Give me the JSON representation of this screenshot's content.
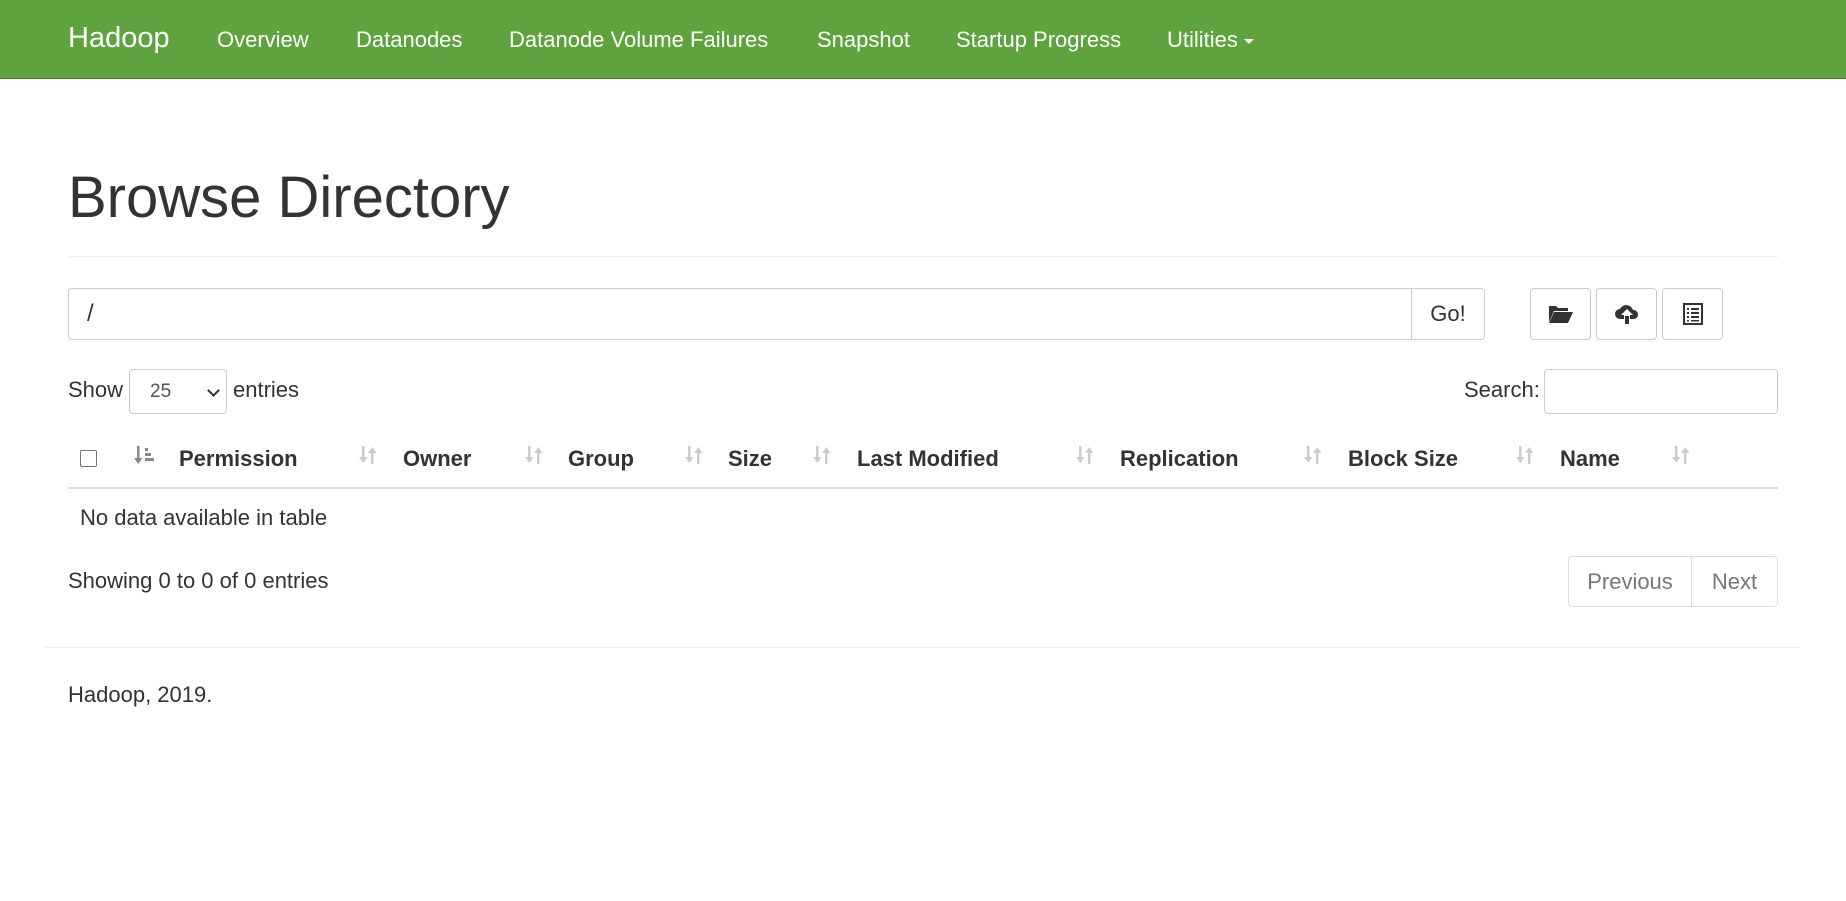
{
  "navbar": {
    "brand": "Hadoop",
    "items": [
      {
        "label": "Overview"
      },
      {
        "label": "Datanodes"
      },
      {
        "label": "Datanode Volume Failures"
      },
      {
        "label": "Snapshot"
      },
      {
        "label": "Startup Progress"
      },
      {
        "label": "Utilities"
      }
    ],
    "color": "#5fa33e"
  },
  "page": {
    "title": "Browse Directory"
  },
  "path_bar": {
    "value": "/",
    "go_label": "Go!",
    "icons": [
      "folder-open-icon",
      "cloud-upload-icon",
      "list-icon"
    ]
  },
  "table_controls": {
    "show_label": "Show",
    "page_size": "25",
    "entries_label": "entries",
    "search_label": "Search:"
  },
  "table": {
    "columns": [
      "Permission",
      "Owner",
      "Group",
      "Size",
      "Last Modified",
      "Replication",
      "Block Size",
      "Name"
    ],
    "empty_message": "No data available in table"
  },
  "pagination": {
    "info": "Showing 0 to 0 of 0 entries",
    "previous": "Previous",
    "next": "Next"
  },
  "footer": {
    "text": "Hadoop, 2019."
  }
}
